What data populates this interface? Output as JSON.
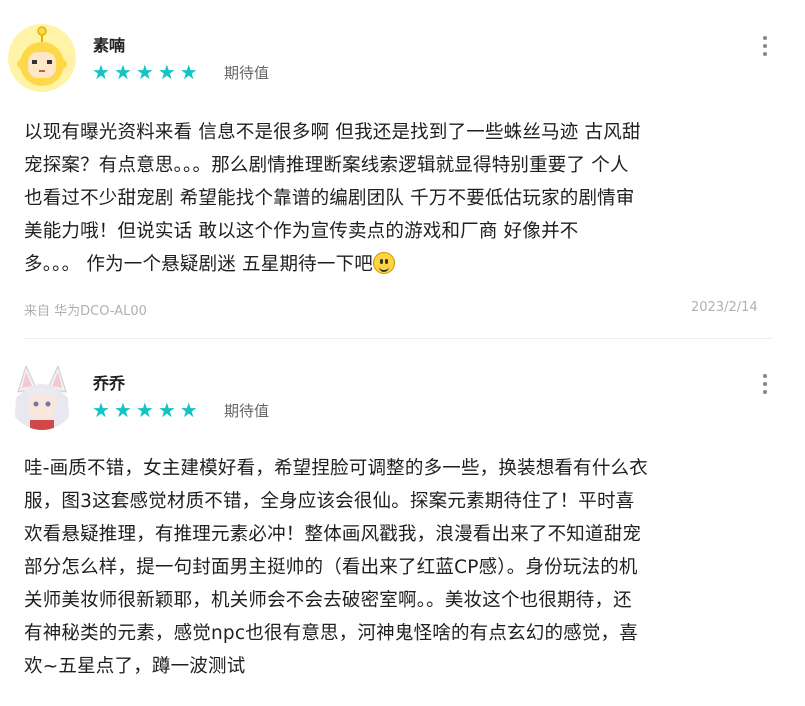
{
  "reviews": [
    {
      "username": "素喃",
      "stars": [
        "★",
        "★",
        "★",
        "★",
        "★"
      ],
      "rating_label": "期待值",
      "avatar_icon": "yellow-cartoon-avatar",
      "text": "以现有曝光资料来看 信息不是很多啊 但我还是找到了一些蛛丝马迹 古风甜\n宠探案？有点意思。。。那么剧情推理断案线索逻辑就显得特别重要了 个人\n也看过不少甜宠剧 希望能找个靠谱的编剧团队 千万不要低估玩家的剧情审\n美能力哦！但说实话 敢以这个作为宣传卖点的游戏和厂商 好像并不\n多。。。 作为一个悬疑剧迷 五星期待一下吧",
      "device": "来自 华为DCO-AL00",
      "date": "2023/2/14"
    },
    {
      "username": "乔乔",
      "stars": [
        "★",
        "★",
        "★",
        "★",
        "★"
      ],
      "rating_label": "期待值",
      "avatar_icon": "fox-ear-girl-avatar",
      "text": "哇-画质不错，女主建模好看，希望捏脸可调整的多一些，换装想看有什么衣\n服，图3这套感觉材质不错，全身应该会很仙。探案元素期待住了！平时喜\n欢看悬疑推理，有推理元素必冲！整体画风戳我，浪漫看出来了不知道甜宠\n部分怎么样，提一句封面男主挺帅的（看出来了红蓝CP感）。身份玩法的机\n关师美妆师很新颖耶，机关师会不会去破密室啊。。美妆这个也很期待，还\n有神秘类的元素，感觉npc也很有意思，河神鬼怪啥的有点玄幻的感觉，喜\n欢~五星点了，蹲一波测试"
    }
  ],
  "colors": {
    "star": "#14c3c3",
    "meta": "#b0b0b0"
  },
  "icons": {
    "emoji": "grinning-face-emoji",
    "menu": "more-vertical-icon"
  }
}
